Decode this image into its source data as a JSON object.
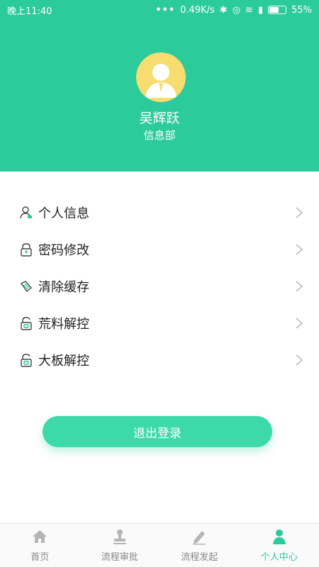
{
  "status_bar": {
    "time": "晚上11:40",
    "network_speed": "0.49K/s",
    "battery": "55%"
  },
  "profile": {
    "name": "吴辉跃",
    "department": "信息部"
  },
  "menu": {
    "items": [
      {
        "label": "个人信息",
        "icon": "user-icon"
      },
      {
        "label": "密码修改",
        "icon": "lock-icon"
      },
      {
        "label": "清除缓存",
        "icon": "broom-icon"
      },
      {
        "label": "荒料解控",
        "icon": "unlock-icon"
      },
      {
        "label": "大板解控",
        "icon": "unlock-icon"
      }
    ]
  },
  "logout_label": "退出登录",
  "tabs": [
    {
      "label": "首页",
      "icon": "home-icon"
    },
    {
      "label": "流程审批",
      "icon": "stamp-icon"
    },
    {
      "label": "流程发起",
      "icon": "pen-icon"
    },
    {
      "label": "个人中心",
      "icon": "person-icon",
      "active": true
    }
  ],
  "colors": {
    "primary": "#2ccb9b",
    "button": "#3ed9a8",
    "avatar_bg": "#f7dc6f"
  }
}
